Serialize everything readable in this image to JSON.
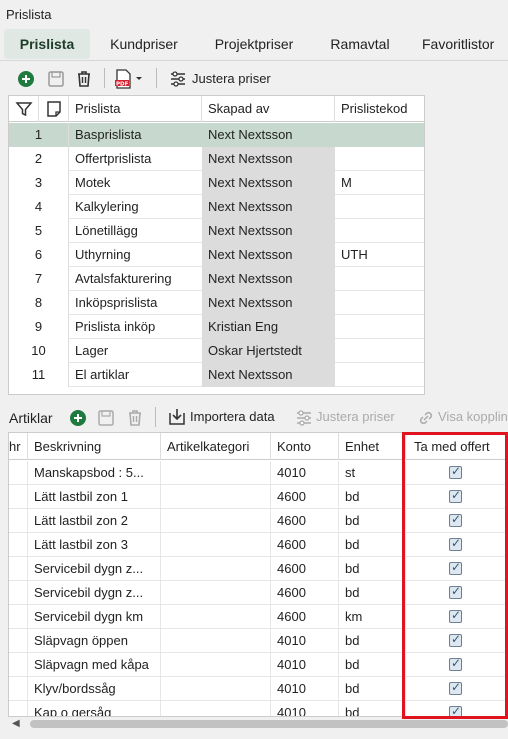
{
  "window": {
    "title": "Prislista"
  },
  "tabs": [
    {
      "label": "Prislista",
      "active": true
    },
    {
      "label": "Kundpriser",
      "active": false
    },
    {
      "label": "Projektpriser",
      "active": false
    },
    {
      "label": "Ramavtal",
      "active": false
    },
    {
      "label": "Favoritlistor",
      "active": false
    }
  ],
  "toolbar": {
    "adjust_label": "Justera priser",
    "icons": [
      "add-icon",
      "save-icon",
      "delete-icon",
      "pdf-icon",
      "sliders-icon"
    ]
  },
  "pricelists": {
    "columns": [
      "Prislista",
      "Skapad av",
      "Prislistekod"
    ],
    "rows": [
      {
        "n": "1",
        "name": "Basprislista",
        "created_by": "Next Nextsson",
        "code": "",
        "selected": true
      },
      {
        "n": "2",
        "name": "Offertprislista",
        "created_by": "Next Nextsson",
        "code": ""
      },
      {
        "n": "3",
        "name": "Motek",
        "created_by": "Next Nextsson",
        "code": "M"
      },
      {
        "n": "4",
        "name": "Kalkylering",
        "created_by": "Next Nextsson",
        "code": ""
      },
      {
        "n": "5",
        "name": "Lönetillägg",
        "created_by": "Next Nextsson",
        "code": ""
      },
      {
        "n": "6",
        "name": "Uthyrning",
        "created_by": "Next Nextsson",
        "code": "UTH"
      },
      {
        "n": "7",
        "name": "Avtalsfakturering",
        "created_by": "Next Nextsson",
        "code": ""
      },
      {
        "n": "8",
        "name": "Inköpsprislista",
        "created_by": "Next Nextsson",
        "code": ""
      },
      {
        "n": "9",
        "name": "Prislista inköp",
        "created_by": "Kristian Eng",
        "code": ""
      },
      {
        "n": "10",
        "name": "Lager",
        "created_by": "Oskar Hjertstedt",
        "code": ""
      },
      {
        "n": "11",
        "name": "El artiklar",
        "created_by": "Next Nextsson",
        "code": ""
      }
    ]
  },
  "articles": {
    "label": "Artiklar",
    "import_label": "Importera data",
    "adjust_label": "Justera priser",
    "links_label": "Visa kopplin",
    "columns": [
      "hr",
      "Beskrivning",
      "Artikelkategori",
      "Konto",
      "Enhet",
      "Ta med offert"
    ],
    "rows": [
      {
        "desc": "Manskapsbod : 5...",
        "category": "",
        "account": "4010",
        "unit": "st",
        "include": true
      },
      {
        "desc": "Lätt lastbil zon 1",
        "category": "",
        "account": "4600",
        "unit": "bd",
        "include": true
      },
      {
        "desc": "Lätt lastbil zon 2",
        "category": "",
        "account": "4600",
        "unit": "bd",
        "include": true
      },
      {
        "desc": "Lätt lastbil zon 3",
        "category": "",
        "account": "4600",
        "unit": "bd",
        "include": true
      },
      {
        "desc": "Servicebil dygn z...",
        "category": "",
        "account": "4600",
        "unit": "bd",
        "include": true
      },
      {
        "desc": "Servicebil dygn z...",
        "category": "",
        "account": "4600",
        "unit": "bd",
        "include": true
      },
      {
        "desc": "Servicebil dygn km",
        "category": "",
        "account": "4600",
        "unit": "km",
        "include": true
      },
      {
        "desc": "Släpvagn öppen",
        "category": "",
        "account": "4010",
        "unit": "bd",
        "include": true
      },
      {
        "desc": "Släpvagn med kåpa",
        "category": "",
        "account": "4010",
        "unit": "bd",
        "include": true
      },
      {
        "desc": "Klyv/bordssåg",
        "category": "",
        "account": "4010",
        "unit": "bd",
        "include": true
      },
      {
        "desc": "Kap o gersåg",
        "category": "",
        "account": "4010",
        "unit": "bd",
        "include": true
      }
    ]
  },
  "colors": {
    "accent": "#1f7a3f",
    "selected_row": "#c7d9cf",
    "highlight": "#e0141e"
  }
}
